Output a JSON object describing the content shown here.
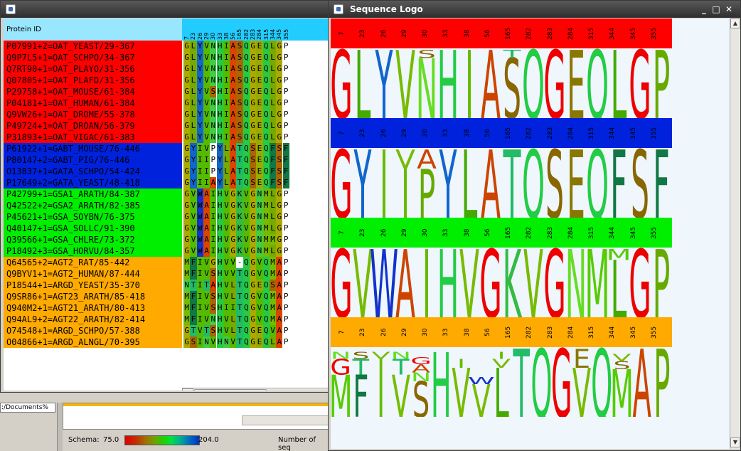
{
  "background": {
    "path_text": ":/Documents%",
    "schema_label": "Schema:",
    "schema_min": "75.0",
    "schema_max": "204.0",
    "count_label": "Number of seq"
  },
  "alignment_window": {
    "header_label": "Protein ID",
    "positions": [
      "7",
      "23",
      "26",
      "29",
      "30",
      "33",
      "38",
      "56",
      "165",
      "282",
      "283",
      "284",
      "315",
      "344",
      "345",
      "355"
    ],
    "groups": [
      {
        "color": "#ff0000",
        "rows": [
          {
            "id": "P07991+2=OAT_YEAST/29-367",
            "residues": "GLYVNHIASQGEQLGP"
          },
          {
            "id": "Q9P7L5+1=OAT_SCHPO/34-367",
            "residues": "GLYVNHIASQGEQLGP"
          },
          {
            "id": "Q7RT90+1=OAT_PLAYO/31-356",
            "residues": "GLYVNHIASQGEQLGP"
          },
          {
            "id": "Q07805+1=OAT_PLAFD/31-356",
            "residues": "GLYVNHIASQGEQLGP"
          },
          {
            "id": "P29758+1=OAT_MOUSE/61-384",
            "residues": "GLYVSHIASQGEQLGP"
          },
          {
            "id": "P04181+1=OAT_HUMAN/61-384",
            "residues": "GLYVNHIASQGEQLGP"
          },
          {
            "id": "Q9VW26+1=OAT_DROME/55-378",
            "residues": "GLYVNHIASQGEQLGP"
          },
          {
            "id": "P49724+1=OAT_DROAN/56-379",
            "residues": "GLYVNHIASQGEQLGP"
          },
          {
            "id": "P31893+1=OAT_VIGAC/61-383",
            "residues": "GLYVNHIASQGEQLGP"
          }
        ]
      },
      {
        "color": "#0022dd",
        "rows": [
          {
            "id": "P61922+1=GABT_MOUSE/76-446",
            "residues": "GYIVPYLATQSEQFSF"
          },
          {
            "id": "P80147+2=GABT_PIG/76-446",
            "residues": "GYIIPYLATQSEQFSF"
          },
          {
            "id": "O13837+1=GATA_SCHPO/54-424",
            "residues": "GYIIPYLATQSEQFSF"
          },
          {
            "id": "P17649+2=GATA_YEAST/48-418",
            "residues": "GYIIAYLATQSEQFSF"
          }
        ]
      },
      {
        "color": "#00ee00",
        "rows": [
          {
            "id": "P42799+1=GSA1_ARATH/84-387",
            "residues": "GVWAIHVGKVGNMLGP"
          },
          {
            "id": "Q42522+2=GSA2_ARATH/82-385",
            "residues": "GVWAIHVGKVGNMLGP"
          },
          {
            "id": "P45621+1=GSA_SOYBN/76-375",
            "residues": "GVWAIHVGKVGNMLGP"
          },
          {
            "id": "Q40147+1=GSA_SOLLC/91-390",
            "residues": "GVWAIHVGKVGNMLGP"
          },
          {
            "id": "Q39566+1=GSA_CHLRE/73-372",
            "residues": "GVWAIHVGKVGNMMGP"
          },
          {
            "id": "P18492+3=GSA_HORVU/84-357",
            "residues": "GVWAIHVGKVGNMLGP"
          }
        ]
      },
      {
        "color": "#ffaa00",
        "rows": [
          {
            "id": "Q64565+2=AGT2_RAT/85-442",
            "residues": "MFIVGHVV-QGVQMAP"
          },
          {
            "id": "Q9BYV1+1=AGT2_HUMAN/87-444",
            "residues": "MFIVSHVVTQGVQMAP"
          },
          {
            "id": "P18544+1=ARGD_YEAST/35-370",
            "residues": "NTITAHVLTQGEOSAP"
          },
          {
            "id": "Q9SR86+1=AGT23_ARATH/85-418",
            "residues": "MFIVSHVLTQGVQMAP"
          },
          {
            "id": "Q940M2+1=AGT21_ARATH/80-413",
            "residues": "MFIVSHIITQGVQMAP"
          },
          {
            "id": "Q94AL9+2=AGT22_ARATH/82-414",
            "residues": "MFIVNHVLTQGVQMAP"
          },
          {
            "id": "O74548+1=ARGD_SCHPO/57-388",
            "residues": "GTVTSHVLTQGEQVAP"
          },
          {
            "id": "O04866+1=ARGD_ALNGL/70-395",
            "residues": "GSINVHNVTQGEQLAP"
          }
        ]
      }
    ]
  },
  "logo_window": {
    "title": "Sequence Logo",
    "positions": [
      "7",
      "23",
      "26",
      "29",
      "30",
      "33",
      "38",
      "56",
      "165",
      "282",
      "283",
      "284",
      "315",
      "344",
      "345",
      "355"
    ],
    "groups": [
      {
        "color": "#ff0000",
        "columns": [
          {
            "stack": [
              {
                "r": "G",
                "h": 1.0
              }
            ]
          },
          {
            "stack": [
              {
                "r": "L",
                "h": 1.0
              }
            ]
          },
          {
            "stack": [
              {
                "r": "Y",
                "h": 1.0
              }
            ]
          },
          {
            "stack": [
              {
                "r": "V",
                "h": 1.0
              }
            ]
          },
          {
            "stack": [
              {
                "r": "N",
                "h": 0.88
              },
              {
                "r": "S",
                "h": 0.12
              }
            ]
          },
          {
            "stack": [
              {
                "r": "H",
                "h": 1.0
              }
            ]
          },
          {
            "stack": [
              {
                "r": "I",
                "h": 1.0
              }
            ]
          },
          {
            "stack": [
              {
                "r": "A",
                "h": 1.0
              }
            ]
          },
          {
            "stack": [
              {
                "r": "S",
                "h": 0.88
              },
              {
                "r": "T",
                "h": 0.12
              }
            ]
          },
          {
            "stack": [
              {
                "r": "Q",
                "h": 1.0
              }
            ]
          },
          {
            "stack": [
              {
                "r": "G",
                "h": 1.0
              }
            ]
          },
          {
            "stack": [
              {
                "r": "E",
                "h": 1.0
              }
            ]
          },
          {
            "stack": [
              {
                "r": "Q",
                "h": 1.0
              }
            ]
          },
          {
            "stack": [
              {
                "r": "L",
                "h": 1.0
              }
            ]
          },
          {
            "stack": [
              {
                "r": "G",
                "h": 1.0
              }
            ]
          },
          {
            "stack": [
              {
                "r": "P",
                "h": 1.0
              }
            ]
          }
        ]
      },
      {
        "color": "#0022dd",
        "columns": [
          {
            "stack": [
              {
                "r": "G",
                "h": 1.0
              }
            ]
          },
          {
            "stack": [
              {
                "r": "Y",
                "h": 1.0
              }
            ]
          },
          {
            "stack": [
              {
                "r": "I",
                "h": 1.0
              }
            ]
          },
          {
            "stack": [
              {
                "r": "I",
                "h": 0.72
              },
              {
                "r": "V",
                "h": 0.28
              }
            ]
          },
          {
            "stack": [
              {
                "r": "P",
                "h": 0.72
              },
              {
                "r": "A",
                "h": 0.28
              }
            ]
          },
          {
            "stack": [
              {
                "r": "Y",
                "h": 1.0
              }
            ]
          },
          {
            "stack": [
              {
                "r": "L",
                "h": 1.0
              }
            ]
          },
          {
            "stack": [
              {
                "r": "A",
                "h": 1.0
              }
            ]
          },
          {
            "stack": [
              {
                "r": "T",
                "h": 1.0
              }
            ]
          },
          {
            "stack": [
              {
                "r": "Q",
                "h": 1.0
              }
            ]
          },
          {
            "stack": [
              {
                "r": "S",
                "h": 1.0
              }
            ]
          },
          {
            "stack": [
              {
                "r": "E",
                "h": 1.0
              }
            ]
          },
          {
            "stack": [
              {
                "r": "Q",
                "h": 1.0
              }
            ]
          },
          {
            "stack": [
              {
                "r": "F",
                "h": 1.0
              }
            ]
          },
          {
            "stack": [
              {
                "r": "S",
                "h": 1.0
              }
            ]
          },
          {
            "stack": [
              {
                "r": "F",
                "h": 1.0
              }
            ]
          }
        ]
      },
      {
        "color": "#00ee00",
        "columns": [
          {
            "stack": [
              {
                "r": "G",
                "h": 1.0
              }
            ]
          },
          {
            "stack": [
              {
                "r": "V",
                "h": 1.0
              }
            ]
          },
          {
            "stack": [
              {
                "r": "W",
                "h": 1.0
              }
            ]
          },
          {
            "stack": [
              {
                "r": "A",
                "h": 1.0
              }
            ]
          },
          {
            "stack": [
              {
                "r": "I",
                "h": 1.0
              }
            ]
          },
          {
            "stack": [
              {
                "r": "H",
                "h": 1.0
              }
            ]
          },
          {
            "stack": [
              {
                "r": "V",
                "h": 1.0
              }
            ]
          },
          {
            "stack": [
              {
                "r": "G",
                "h": 1.0
              }
            ]
          },
          {
            "stack": [
              {
                "r": "K",
                "h": 1.0
              }
            ]
          },
          {
            "stack": [
              {
                "r": "V",
                "h": 1.0
              }
            ]
          },
          {
            "stack": [
              {
                "r": "G",
                "h": 1.0
              }
            ]
          },
          {
            "stack": [
              {
                "r": "N",
                "h": 1.0
              }
            ]
          },
          {
            "stack": [
              {
                "r": "M",
                "h": 1.0
              }
            ]
          },
          {
            "stack": [
              {
                "r": "L",
                "h": 0.84
              },
              {
                "r": "M",
                "h": 0.16
              }
            ]
          },
          {
            "stack": [
              {
                "r": "G",
                "h": 1.0
              }
            ]
          },
          {
            "stack": [
              {
                "r": "P",
                "h": 1.0
              }
            ]
          }
        ]
      },
      {
        "color": "#ffaa00",
        "columns": [
          {
            "stack": [
              {
                "r": "M",
                "h": 0.62
              },
              {
                "r": "G",
                "h": 0.23
              },
              {
                "r": "N",
                "h": 0.1
              }
            ]
          },
          {
            "stack": [
              {
                "r": "F",
                "h": 0.62
              },
              {
                "r": "T",
                "h": 0.23
              },
              {
                "r": "S",
                "h": 0.1
              }
            ]
          },
          {
            "stack": [
              {
                "r": "I",
                "h": 0.85
              },
              {
                "r": "V",
                "h": 0.1
              }
            ]
          },
          {
            "stack": [
              {
                "r": "V",
                "h": 0.62
              },
              {
                "r": "T",
                "h": 0.23
              },
              {
                "r": "N",
                "h": 0.1
              }
            ]
          },
          {
            "stack": [
              {
                "r": "S",
                "h": 0.52
              },
              {
                "r": "N",
                "h": 0.13
              },
              {
                "r": "A",
                "h": 0.12
              },
              {
                "r": "G",
                "h": 0.1
              }
            ]
          },
          {
            "stack": [
              {
                "r": "H",
                "h": 0.95
              }
            ]
          },
          {
            "stack": [
              {
                "r": "V",
                "h": 0.72
              },
              {
                "r": "I",
                "h": 0.13
              }
            ]
          },
          {
            "stack": [
              {
                "r": "V",
                "h": 0.48
              },
              {
                "r": "W",
                "h": 0.1
              }
            ]
          },
          {
            "stack": [
              {
                "r": "L",
                "h": 0.72
              },
              {
                "r": "V",
                "h": 0.13
              },
              {
                "r": "I",
                "h": 0.1
              }
            ]
          },
          {
            "stack": [
              {
                "r": "T",
                "h": 1.0
              }
            ]
          },
          {
            "stack": [
              {
                "r": "Q",
                "h": 1.0
              }
            ]
          },
          {
            "stack": [
              {
                "r": "G",
                "h": 1.0
              }
            ]
          },
          {
            "stack": [
              {
                "r": "V",
                "h": 0.72
              },
              {
                "r": "E",
                "h": 0.28
              }
            ]
          },
          {
            "stack": [
              {
                "r": "Q",
                "h": 1.0
              }
            ]
          },
          {
            "stack": [
              {
                "r": "M",
                "h": 0.7
              },
              {
                "r": "S",
                "h": 0.12
              },
              {
                "r": "V",
                "h": 0.1
              }
            ]
          },
          {
            "stack": [
              {
                "r": "A",
                "h": 1.0
              }
            ]
          },
          {
            "stack": [
              {
                "r": "P",
                "h": 1.0
              }
            ]
          }
        ]
      }
    ]
  },
  "residue_colors": {
    "G": "#ee0000",
    "L": "#44aa00",
    "Y": "#1166cc",
    "V": "#77bb00",
    "N": "#66dd22",
    "H": "#22cc44",
    "I": "#66bb00",
    "A": "#cc4400",
    "S": "#886600",
    "Q": "#22cc44",
    "E": "#887700",
    "P": "#66aa00",
    "T": "#22bb66",
    "F": "#117744",
    "M": "#55cc00",
    "W": "#1133cc",
    "K": "#33bb44",
    "C": "#aaaa00",
    "-": "#ffffff"
  },
  "cell_colors": {
    "G": "#aaaa00",
    "L": "#77aa00",
    "Y": "#1166cc",
    "V": "#55bb00",
    "N": "#44cc44",
    "H": "#22cc44",
    "I": "#55bb00",
    "A": "#dd4400",
    "S": "#aa6600",
    "Q": "#22cc44",
    "E": "#99aa00",
    "P": "#ffffff",
    "T": "#22bb66",
    "F": "#117744",
    "M": "#77bb00",
    "W": "#1133cc",
    "K": "#33bb44",
    "-": "#ffffff"
  }
}
